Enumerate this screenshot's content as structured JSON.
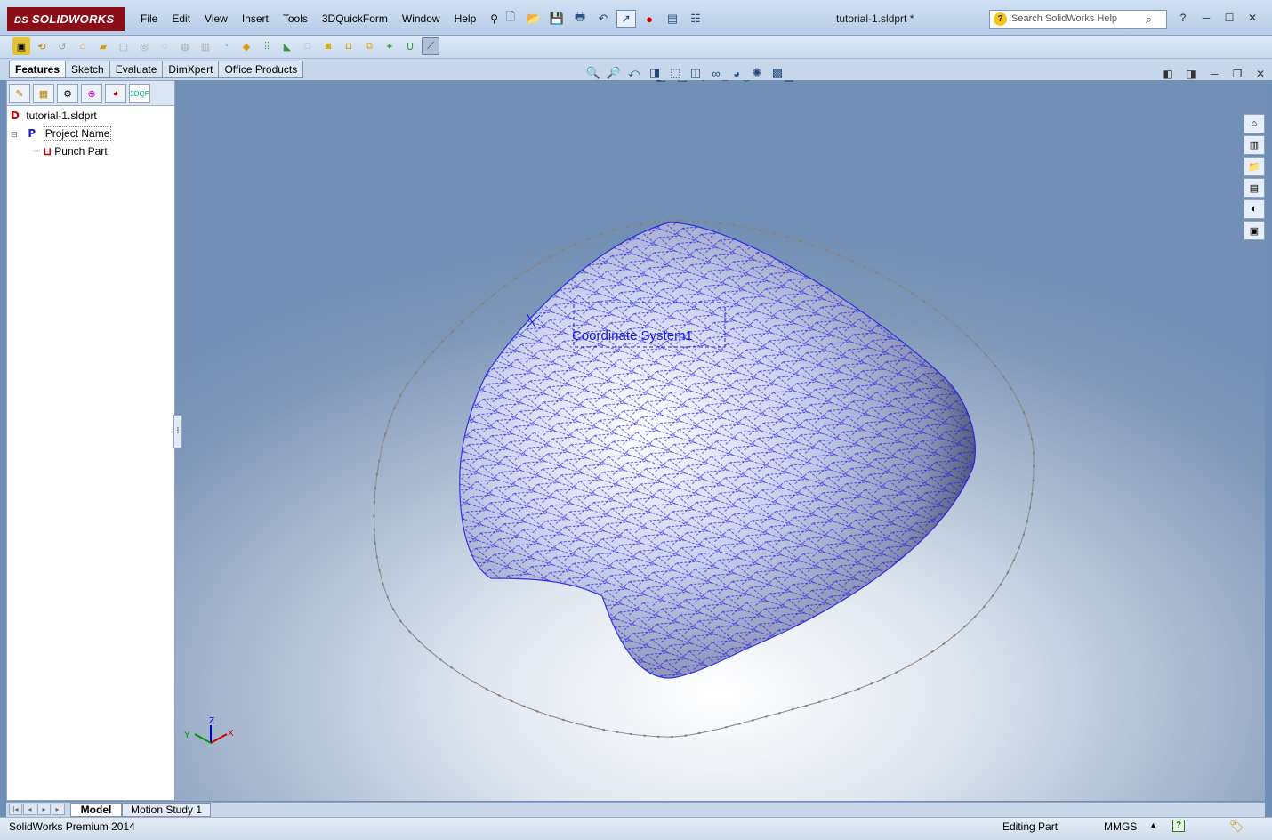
{
  "app": {
    "logo_text": "SOLIDWORKS",
    "logo_mark": "DS",
    "document_title": "tutorial-1.sldprt *"
  },
  "menu": [
    {
      "label": "File"
    },
    {
      "label": "Edit"
    },
    {
      "label": "View"
    },
    {
      "label": "Insert"
    },
    {
      "label": "Tools"
    },
    {
      "label": "3DQuickForm"
    },
    {
      "label": "Window"
    },
    {
      "label": "Help"
    }
  ],
  "search": {
    "placeholder": "Search SolidWorks Help"
  },
  "tabs": [
    {
      "label": "Features"
    },
    {
      "label": "Sketch"
    },
    {
      "label": "Evaluate"
    },
    {
      "label": "DimXpert"
    },
    {
      "label": "Office Products"
    }
  ],
  "tree": {
    "root": {
      "icon": "D",
      "label": "tutorial-1.sldprt"
    },
    "project": {
      "icon": "P",
      "label": "Project Name"
    },
    "child": {
      "icon": "punch-icon",
      "label": "Punch Part"
    }
  },
  "viewport": {
    "annotation": "Coordinate System1",
    "triad": {
      "x": "X",
      "y": "Y",
      "z": "Z"
    }
  },
  "bottom_tabs": [
    {
      "label": "Model"
    },
    {
      "label": "Motion Study 1"
    }
  ],
  "status": {
    "product": "SolidWorks Premium 2014",
    "mode": "Editing Part",
    "units": "MMGS",
    "arrow": "▴",
    "help": "?"
  },
  "colors": {
    "brand": "#8b0d16",
    "mesh": "#1a1ae6",
    "outline": "#777777"
  }
}
